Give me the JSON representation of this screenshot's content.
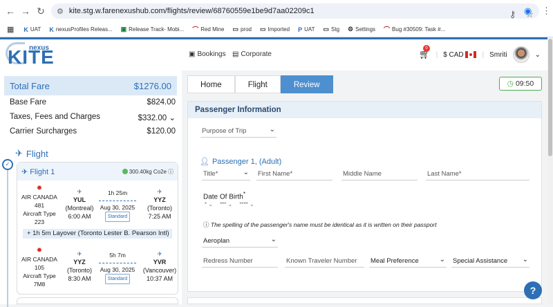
{
  "browser": {
    "url": "kite.stg.w.farenexushub.com/flights/review/68760559e1be9d7aa02209c1",
    "bookmarks": [
      "UAT",
      "nexusProfiles Releas...",
      "Release Track- Mobi...",
      "Red Mine",
      "prod",
      "Imported",
      "UAT",
      "Stg",
      "Settings",
      "Bug #30509: Task #..."
    ]
  },
  "header": {
    "logo_small": "nexus",
    "logo_big": "KITE",
    "bookings": "Bookings",
    "corporate": "Corporate",
    "cart_count": "0",
    "currency": "$ CAD",
    "user": "Smriti"
  },
  "fare": {
    "total_label": "Total Fare",
    "total_value": "$1276.00",
    "rows": [
      {
        "label": "Base Fare",
        "value": "$824.00"
      },
      {
        "label": "Taxes, Fees and Charges",
        "value": "$332.00"
      },
      {
        "label": "Carrier Surcharges",
        "value": "$120.00"
      }
    ]
  },
  "flight": {
    "section_title": "Flight",
    "card_title": "Flight 1",
    "co2": "300.40kg Co2e",
    "segments": [
      {
        "airline": "AIR CANADA",
        "number": "481",
        "aircraft_label": "Aircraft Type",
        "aircraft": "223",
        "from_code": "YUL",
        "from_city": "(Montreal)",
        "from_time": "6:00 AM",
        "duration": "1h 25m",
        "date": "Aug 30, 2025",
        "cabin": "Standard",
        "to_code": "YYZ",
        "to_city": "(Toronto)",
        "to_time": "7:25 AM"
      },
      {
        "airline": "AIR CANADA",
        "number": "105",
        "aircraft_label": "Aircraft Type",
        "aircraft": "7M8",
        "from_code": "YYZ",
        "from_city": "(Toronto)",
        "from_time": "8:30 AM",
        "duration": "5h 7m",
        "date": "Aug 30, 2025",
        "cabin": "Standard",
        "to_code": "YVR",
        "to_city": "(Vancouver)",
        "to_time": "10:37 AM"
      }
    ],
    "layover": "+ 1h 5m Layover (Toronto Lester B. Pearson Intl)"
  },
  "breadcrumb": [
    "Home",
    "Flight",
    "Review"
  ],
  "timer": "09:50",
  "passenger": {
    "section_title": "Passenger Information",
    "purpose": "Purpose of Trip",
    "title": "Passenger 1, (Adult)",
    "fields": {
      "title": "Title*",
      "first": "First Name*",
      "middle": "Middle Name",
      "last": "Last Name*",
      "dob": "Date Of Birth",
      "dob_star": "*",
      "dob_d": "*",
      "dob_m": "***",
      "dob_y": "****",
      "program": "Aeroplan",
      "redress": "Redress Number",
      "ktn": "Known Traveler Number",
      "meal": "Meal Preference",
      "assist": "Special Assistance"
    },
    "note": "The spelling of the passenger's name must be identical as it is written on their passport"
  },
  "help": "?"
}
